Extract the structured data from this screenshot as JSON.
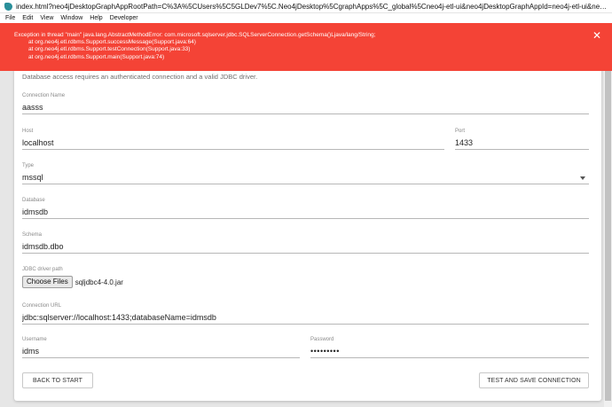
{
  "window": {
    "title": "index.html?neo4jDesktopGraphAppRootPath=C%3A%5CUsers%5C5GLDev7%5C.Neo4jDesktop%5CgraphApps%5C_global%5Cneo4j-etl-ui&neo4jDesktopGraphAppId=neo4j-etl-ui&neo4jD..."
  },
  "menu": {
    "items": [
      "File",
      "Edit",
      "View",
      "Window",
      "Help",
      "Developer"
    ]
  },
  "error": {
    "lines": [
      "Exception in thread \"main\" java.lang.AbstractMethodError: com.microsoft.sqlserver.jdbc.SQLServerConnection.getSchema()Ljava/lang/String;",
      "at org.neo4j.etl.rdbms.Support.successMessage(Support.java:64)",
      "at org.neo4j.etl.rdbms.Support.testConnection(Support.java:33)",
      "at org.neo4j.etl.rdbms.Support.main(Support.java:74)"
    ],
    "close_glyph": "✕",
    "color": "#f44336"
  },
  "form": {
    "intro": "Database access requires an authenticated connection and a valid JDBC driver.",
    "connection_name": {
      "label": "Connection Name",
      "value": "aasss"
    },
    "host": {
      "label": "Host",
      "value": "localhost"
    },
    "port": {
      "label": "Port",
      "value": "1433"
    },
    "type": {
      "label": "Type",
      "value": "mssql"
    },
    "database": {
      "label": "Database",
      "value": "idmsdb"
    },
    "schema": {
      "label": "Schema",
      "value": "idmsdb.dbo"
    },
    "jdbc": {
      "label": "JDBC driver path",
      "button": "Choose Files",
      "file": "sqljdbc4-4.0.jar"
    },
    "connection_url": {
      "label": "Connection URL",
      "value": "jdbc:sqlserver://localhost:1433;databaseName=idmsdb"
    },
    "username": {
      "label": "Username",
      "value": "idms"
    },
    "password": {
      "label": "Password",
      "value": "•••••••••"
    }
  },
  "buttons": {
    "back": "BACK TO START",
    "test_save": "TEST AND SAVE CONNECTION"
  }
}
